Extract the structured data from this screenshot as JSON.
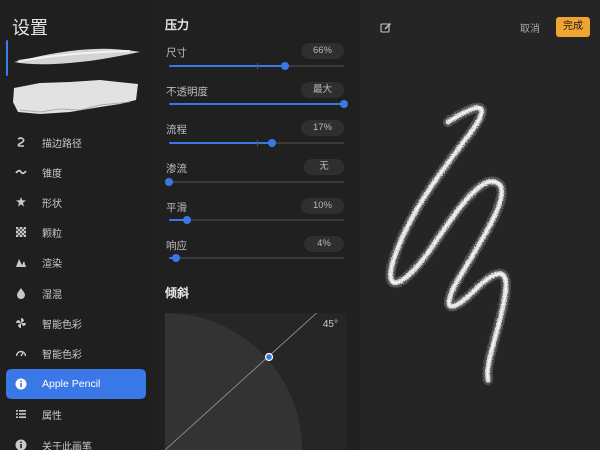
{
  "sidebar": {
    "title": "设置",
    "items": [
      {
        "label": "描边路径",
        "icon": "stroke-path-icon"
      },
      {
        "label": "锥度",
        "icon": "taper-icon"
      },
      {
        "label": "形状",
        "icon": "shape-icon"
      },
      {
        "label": "颗粒",
        "icon": "grain-icon"
      },
      {
        "label": "渲染",
        "icon": "rendering-icon"
      },
      {
        "label": "湿混",
        "icon": "wet-mix-icon"
      },
      {
        "label": "智能色彩",
        "icon": "color-dynamics-icon"
      },
      {
        "label": "智能色彩",
        "icon": "dynamics-icon"
      },
      {
        "label": "Apple Pencil",
        "icon": "info-icon",
        "active": true
      },
      {
        "label": "属性",
        "icon": "list-icon"
      },
      {
        "label": "关于此画笔",
        "icon": "info-icon"
      }
    ]
  },
  "settings": {
    "pressure_title": "压力",
    "rows": [
      {
        "label": "尺寸",
        "value": "66%",
        "fraction": 0.66
      },
      {
        "label": "不透明度",
        "value": "最大",
        "fraction": 1.0
      },
      {
        "label": "流程",
        "value": "17%",
        "fraction": 0.59
      },
      {
        "label": "渗流",
        "value": "无",
        "fraction": 0.0
      },
      {
        "label": "平滑",
        "value": "10%",
        "fraction": 0.1
      },
      {
        "label": "响应",
        "value": "4%",
        "fraction": 0.04
      }
    ],
    "tilt_title": "倾斜",
    "tilt_angle": "45°"
  },
  "canvas": {
    "cancel_label": "取消",
    "done_label": "完成"
  },
  "colors": {
    "accent": "#3b78e7",
    "done_button": "#f0a531"
  }
}
